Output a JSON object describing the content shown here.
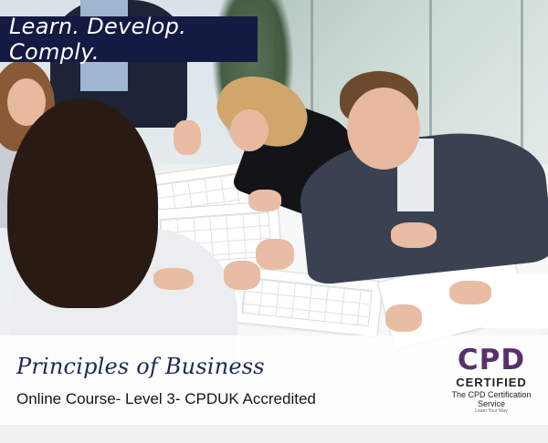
{
  "banner": {
    "tagline": "Learn. Develop. Comply."
  },
  "course": {
    "title": "Principles of Business",
    "subtitle": "Online Course- Level 3- CPDUK Accredited"
  },
  "badge": {
    "mark": "CPD",
    "certified": "CERTIFIED",
    "service_line1": "The CPD Certification",
    "service_line2": "Service",
    "tagline": "Learn Your Way"
  },
  "colors": {
    "banner_bg": "#141a42",
    "title_text": "#1e2a55",
    "cpd_purple": "#58306f"
  }
}
